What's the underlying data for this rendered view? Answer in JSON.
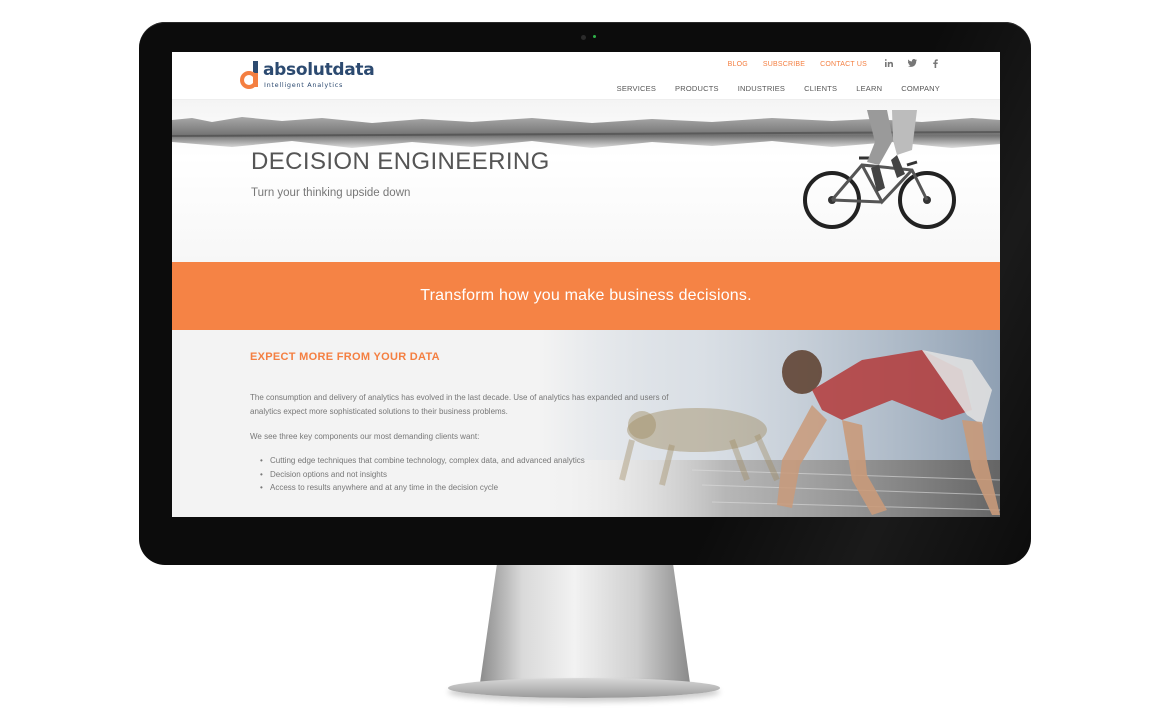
{
  "header": {
    "logo_word": "absolutdata",
    "logo_tagline": "Intelligent Analytics",
    "utility_links": [
      {
        "label": "BLOG"
      },
      {
        "label": "SUBSCRIBE"
      },
      {
        "label": "CONTACT US"
      }
    ],
    "social_icons": [
      "linkedin-icon",
      "twitter-icon",
      "facebook-icon"
    ],
    "nav_items": [
      {
        "label": "SERVICES"
      },
      {
        "label": "PRODUCTS"
      },
      {
        "label": "INDUSTRIES"
      },
      {
        "label": "CLIENTS"
      },
      {
        "label": "LEARN"
      },
      {
        "label": "COMPANY"
      }
    ]
  },
  "hero": {
    "title": "DECISION ENGINEERING",
    "subtitle": "Turn your thinking upside down"
  },
  "band": {
    "text": "Transform how you make business decisions."
  },
  "section": {
    "title": "EXPECT MORE FROM YOUR DATA",
    "paragraph1": "The consumption and delivery of analytics has evolved in the last decade. Use of analytics has expanded and users of analytics expect more sophisticated solutions to their business problems.",
    "paragraph2": "We see three key components our most demanding clients want:",
    "bullets": [
      "Cutting edge techniques that combine technology, complex data, and advanced analytics",
      "Decision options and not insights",
      "Access to results anywhere and at any time in the decision cycle"
    ]
  },
  "colors": {
    "accent": "#f58345",
    "logo_blue": "#2c4a70",
    "text_gray": "#777777"
  }
}
